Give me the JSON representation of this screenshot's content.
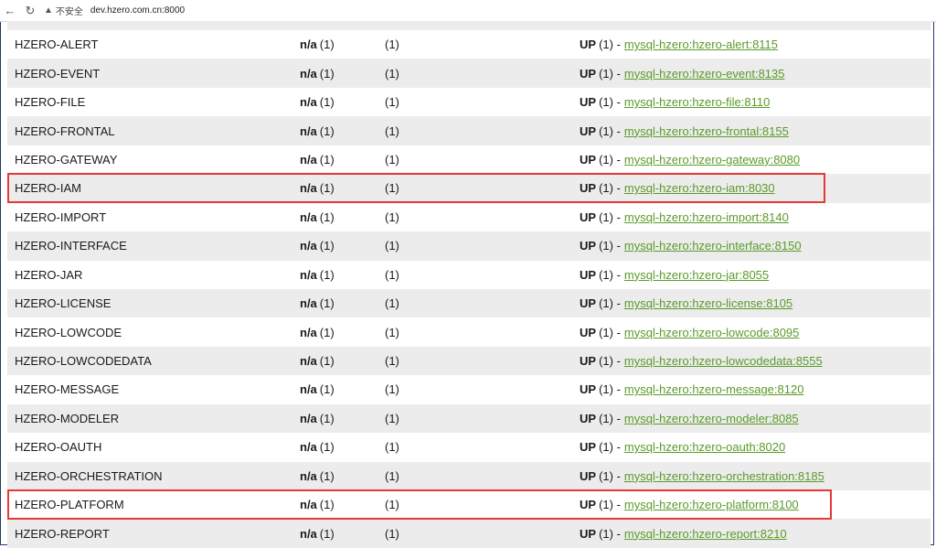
{
  "browser": {
    "back_icon": "back-arrow-icon",
    "reload_icon": "reload-icon",
    "warning_icon": "warning-triangle-icon",
    "insecure_label": "不安全",
    "url": "dev.hzero.com.cn:8000"
  },
  "rows": [
    {
      "name": "HZERO-ALERT",
      "amis": "n/a",
      "amis_count": "(1)",
      "az": "(1)",
      "status": "UP",
      "status_count": "(1) -",
      "link": "mysql-hzero:hzero-alert:8115"
    },
    {
      "name": "HZERO-EVENT",
      "amis": "n/a",
      "amis_count": "(1)",
      "az": "(1)",
      "status": "UP",
      "status_count": "(1) -",
      "link": "mysql-hzero:hzero-event:8135"
    },
    {
      "name": "HZERO-FILE",
      "amis": "n/a",
      "amis_count": "(1)",
      "az": "(1)",
      "status": "UP",
      "status_count": "(1) -",
      "link": "mysql-hzero:hzero-file:8110"
    },
    {
      "name": "HZERO-FRONTAL",
      "amis": "n/a",
      "amis_count": "(1)",
      "az": "(1)",
      "status": "UP",
      "status_count": "(1) -",
      "link": "mysql-hzero:hzero-frontal:8155"
    },
    {
      "name": "HZERO-GATEWAY",
      "amis": "n/a",
      "amis_count": "(1)",
      "az": "(1)",
      "status": "UP",
      "status_count": "(1) -",
      "link": "mysql-hzero:hzero-gateway:8080"
    },
    {
      "name": "HZERO-IAM",
      "amis": "n/a",
      "amis_count": "(1)",
      "az": "(1)",
      "status": "UP",
      "status_count": "(1) -",
      "link": "mysql-hzero:hzero-iam:8030"
    },
    {
      "name": "HZERO-IMPORT",
      "amis": "n/a",
      "amis_count": "(1)",
      "az": "(1)",
      "status": "UP",
      "status_count": "(1) -",
      "link": "mysql-hzero:hzero-import:8140"
    },
    {
      "name": "HZERO-INTERFACE",
      "amis": "n/a",
      "amis_count": "(1)",
      "az": "(1)",
      "status": "UP",
      "status_count": "(1) -",
      "link": "mysql-hzero:hzero-interface:8150"
    },
    {
      "name": "HZERO-JAR",
      "amis": "n/a",
      "amis_count": "(1)",
      "az": "(1)",
      "status": "UP",
      "status_count": "(1) -",
      "link": "mysql-hzero:hzero-jar:8055"
    },
    {
      "name": "HZERO-LICENSE",
      "amis": "n/a",
      "amis_count": "(1)",
      "az": "(1)",
      "status": "UP",
      "status_count": "(1) -",
      "link": "mysql-hzero:hzero-license:8105"
    },
    {
      "name": "HZERO-LOWCODE",
      "amis": "n/a",
      "amis_count": "(1)",
      "az": "(1)",
      "status": "UP",
      "status_count": "(1) -",
      "link": "mysql-hzero:hzero-lowcode:8095"
    },
    {
      "name": "HZERO-LOWCODEDATA",
      "amis": "n/a",
      "amis_count": "(1)",
      "az": "(1)",
      "status": "UP",
      "status_count": "(1) -",
      "link": "mysql-hzero:hzero-lowcodedata:8555"
    },
    {
      "name": "HZERO-MESSAGE",
      "amis": "n/a",
      "amis_count": "(1)",
      "az": "(1)",
      "status": "UP",
      "status_count": "(1) -",
      "link": "mysql-hzero:hzero-message:8120"
    },
    {
      "name": "HZERO-MODELER",
      "amis": "n/a",
      "amis_count": "(1)",
      "az": "(1)",
      "status": "UP",
      "status_count": "(1) -",
      "link": "mysql-hzero:hzero-modeler:8085"
    },
    {
      "name": "HZERO-OAUTH",
      "amis": "n/a",
      "amis_count": "(1)",
      "az": "(1)",
      "status": "UP",
      "status_count": "(1) -",
      "link": "mysql-hzero:hzero-oauth:8020"
    },
    {
      "name": "HZERO-ORCHESTRATION",
      "amis": "n/a",
      "amis_count": "(1)",
      "az": "(1)",
      "status": "UP",
      "status_count": "(1) -",
      "link": "mysql-hzero:hzero-orchestration:8185"
    },
    {
      "name": "HZERO-PLATFORM",
      "amis": "n/a",
      "amis_count": "(1)",
      "az": "(1)",
      "status": "UP",
      "status_count": "(1) -",
      "link": "mysql-hzero:hzero-platform:8100"
    },
    {
      "name": "HZERO-REPORT",
      "amis": "n/a",
      "amis_count": "(1)",
      "az": "(1)",
      "status": "UP",
      "status_count": "(1) -",
      "link": "mysql-hzero:hzero-report:8210"
    }
  ],
  "highlighted_rows": [
    "HZERO-IAM",
    "HZERO-PLATFORM"
  ],
  "colors": {
    "highlight": "#e53935",
    "link": "#5a9b2a",
    "row_alt": "#ececec"
  }
}
